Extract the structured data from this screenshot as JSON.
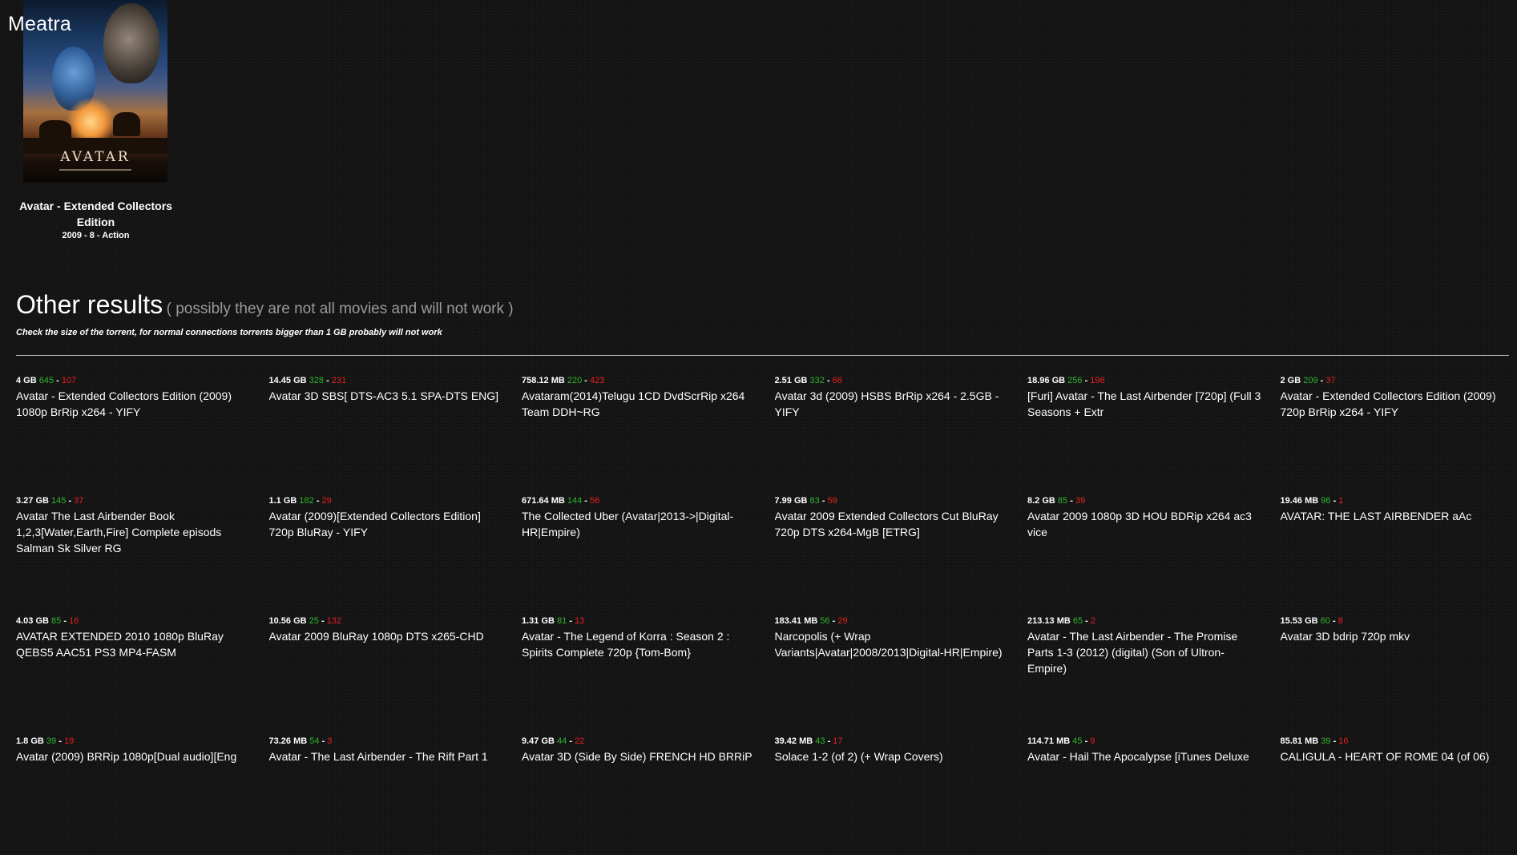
{
  "app": {
    "logo": "Meatra"
  },
  "featured": {
    "poster_title": "AVATAR",
    "title": "Avatar - Extended Collectors Edition",
    "meta": "2009 - 8 - Action"
  },
  "other": {
    "heading": "Other results",
    "note": "( possibly they are not all movies and will not work )",
    "warning": "Check the size of the torrent, for normal connections torrents bigger than 1 GB probably will not work"
  },
  "colors": {
    "seeds": "#2fb52f",
    "leechers": "#e81f1f"
  },
  "results": [
    {
      "size": "4 GB",
      "seeds": "645",
      "leechers": "107",
      "title": "Avatar - Extended Collectors Edition (2009) 1080p BrRip x264 - YIFY"
    },
    {
      "size": "14.45 GB",
      "seeds": "328",
      "leechers": "231",
      "title": "Avatar 3D SBS[ DTS-AC3 5.1 SPA-DTS ENG]"
    },
    {
      "size": "758.12 MB",
      "seeds": "220",
      "leechers": "423",
      "title": "Avataram(2014)Telugu 1CD DvdScrRip x264 Team DDH~RG"
    },
    {
      "size": "2.51 GB",
      "seeds": "332",
      "leechers": "66",
      "title": "Avatar 3d (2009) HSBS BrRip x264 - 2.5GB - YIFY"
    },
    {
      "size": "18.96 GB",
      "seeds": "256",
      "leechers": "196",
      "title": "[Furi] Avatar - The Last Airbender [720p] (Full 3 Seasons + Extr"
    },
    {
      "size": "2 GB",
      "seeds": "209",
      "leechers": "37",
      "title": "Avatar - Extended Collectors Edition (2009) 720p BrRip x264 - YIFY"
    },
    {
      "size": "3.27 GB",
      "seeds": "145",
      "leechers": "37",
      "title": "Avatar The Last Airbender Book 1,2,3[Water,Earth,Fire] Complete episods Salman Sk Silver RG"
    },
    {
      "size": "1.1 GB",
      "seeds": "182",
      "leechers": "29",
      "title": "Avatar (2009)[Extended Collectors Edition] 720p BluRay - YIFY"
    },
    {
      "size": "671.64 MB",
      "seeds": "144",
      "leechers": "56",
      "title": "The Collected Uber (Avatar|2013->|Digital-HR|Empire)"
    },
    {
      "size": "7.99 GB",
      "seeds": "83",
      "leechers": "59",
      "title": "Avatar 2009 Extended Collectors Cut BluRay 720p DTS x264-MgB [ETRG]"
    },
    {
      "size": "8.2 GB",
      "seeds": "85",
      "leechers": "39",
      "title": "Avatar 2009 1080p 3D HOU BDRip x264 ac3 vice"
    },
    {
      "size": "19.46 MB",
      "seeds": "96",
      "leechers": "1",
      "title": "AVATAR: THE LAST AIRBENDER aAc"
    },
    {
      "size": "4.03 GB",
      "seeds": "85",
      "leechers": "16",
      "title": "AVATAR EXTENDED 2010 1080p BluRay QEBS5 AAC51 PS3 MP4-FASM"
    },
    {
      "size": "10.56 GB",
      "seeds": "25",
      "leechers": "132",
      "title": "Avatar 2009 BluRay 1080p DTS x265-CHD"
    },
    {
      "size": "1.31 GB",
      "seeds": "81",
      "leechers": "13",
      "title": "Avatar - The Legend of Korra : Season 2 : Spirits Complete 720p {Tom-Bom}"
    },
    {
      "size": "183.41 MB",
      "seeds": "56",
      "leechers": "29",
      "title": "Narcopolis (+ Wrap Variants|Avatar|2008/2013|Digital-HR|Empire)"
    },
    {
      "size": "213.13 MB",
      "seeds": "65",
      "leechers": "2",
      "title": "Avatar - The Last Airbender - The Promise Parts 1-3 (2012) (digital) (Son of Ultron-Empire)"
    },
    {
      "size": "15.53 GB",
      "seeds": "60",
      "leechers": "8",
      "title": "Avatar 3D bdrip 720p mkv"
    },
    {
      "size": "1.8 GB",
      "seeds": "39",
      "leechers": "19",
      "title": "Avatar (2009) BRRip 1080p[Dual audio][Eng"
    },
    {
      "size": "73.26 MB",
      "seeds": "54",
      "leechers": "3",
      "title": "Avatar - The Last Airbender - The Rift Part 1"
    },
    {
      "size": "9.47 GB",
      "seeds": "44",
      "leechers": "22",
      "title": "Avatar 3D (Side By Side) FRENCH HD BRRiP"
    },
    {
      "size": "39.42 MB",
      "seeds": "43",
      "leechers": "17",
      "title": "Solace 1-2 (of 2) (+ Wrap Covers)"
    },
    {
      "size": "114.71 MB",
      "seeds": "45",
      "leechers": "9",
      "title": "Avatar - Hail The Apocalypse [iTunes Deluxe"
    },
    {
      "size": "85.81 MB",
      "seeds": "39",
      "leechers": "16",
      "title": "CALIGULA - HEART OF ROME 04 (of 06)"
    }
  ]
}
